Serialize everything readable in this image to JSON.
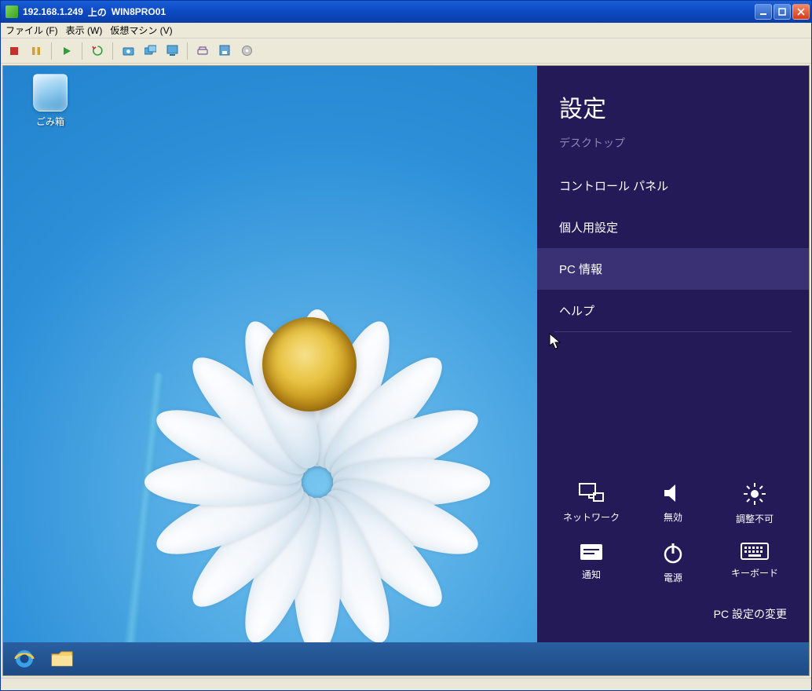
{
  "titlebar": {
    "ip_host": "192.168.1.249",
    "mid": "上の",
    "vm_name": "WIN8PRO01"
  },
  "menu": {
    "file": "ファイル (F)",
    "view": "表示 (W)",
    "vm": "仮想マシン (V)"
  },
  "toolbar_icons": [
    "stop-icon",
    "pause-icon",
    "play-icon",
    "refresh-icon",
    "snapshot-icon",
    "snapshot-manager-icon",
    "fullscreen-icon",
    "cad-icon",
    "floppy-icon",
    "cd-icon"
  ],
  "desktop": {
    "recycle_bin_label": "ごみ箱"
  },
  "charms": {
    "title": "設定",
    "subtitle": "デスクトップ",
    "items": [
      {
        "label": "コントロール パネル",
        "hover": false
      },
      {
        "label": "個人用設定",
        "hover": false
      },
      {
        "label": "PC 情報",
        "hover": true
      },
      {
        "label": "ヘルプ",
        "hover": false
      }
    ],
    "tiles": [
      {
        "name": "network-icon",
        "label": "ネットワーク"
      },
      {
        "name": "volume-icon",
        "label": "無効"
      },
      {
        "name": "brightness-icon",
        "label": "調整不可"
      },
      {
        "name": "notify-icon",
        "label": "通知"
      },
      {
        "name": "power-icon",
        "label": "電源"
      },
      {
        "name": "keyboard-icon",
        "label": "キーボード"
      }
    ],
    "footer_link": "PC 設定の変更"
  }
}
